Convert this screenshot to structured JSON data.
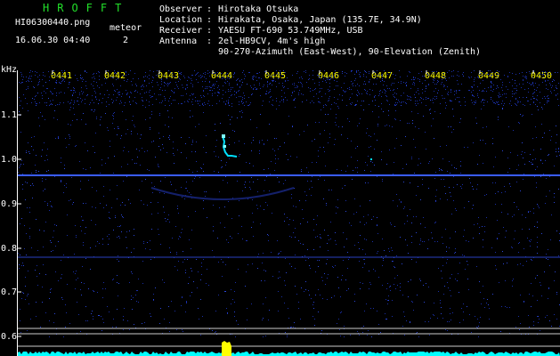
{
  "header": {
    "app_title": "HROFFT",
    "filename": "HI06300440.png",
    "meteor_label": "meteor",
    "meteor_count": "2",
    "datetime": "16.06.30 04:40",
    "info_keys": [
      "Observer",
      "Location",
      "Receiver",
      "Antenna",
      ""
    ],
    "info_values": [
      "Hirotaka Otsuka",
      "Hirakata, Osaka, Japan (135.7E, 34.9N)",
      "YAESU FT-690 53.749MHz, USB",
      "2el-HB9CV, 4m's high",
      "90-270-Azimuth (East-West), 90-Elevation (Zenith)"
    ]
  },
  "axis": {
    "unit": "kHz",
    "freq_ticks": [
      "1.1",
      "1.0",
      "0.9",
      "0.8",
      "0.7",
      "0.6"
    ],
    "time_ticks": [
      "0441",
      "0442",
      "0443",
      "0444",
      "0445",
      "0446",
      "0447",
      "0448",
      "0449",
      "0450"
    ]
  },
  "colors": {
    "background": "#000000",
    "noise": "#1a2fa8",
    "carrier_line": "#3a5cff",
    "echo": "#00e0ff",
    "time_tick_text": "#ffff00",
    "title_text": "#22e02a",
    "baseline_bar": "#00ffff",
    "baseline_peak": "#ffff00"
  }
}
